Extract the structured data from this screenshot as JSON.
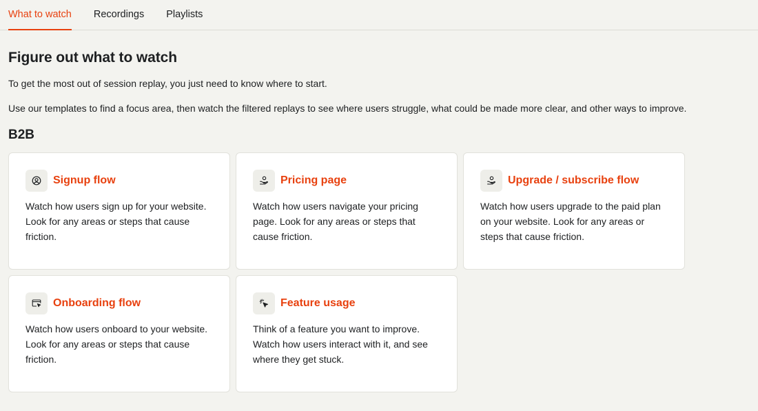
{
  "tabs": [
    {
      "label": "What to watch",
      "active": true
    },
    {
      "label": "Recordings",
      "active": false
    },
    {
      "label": "Playlists",
      "active": false
    }
  ],
  "main": {
    "title": "Figure out what to watch",
    "intro_1": "To get the most out of session replay, you just need to know where to start.",
    "intro_2": "Use our templates to find a focus area, then watch the filtered replays to see where users struggle, what could be made more clear, and other ways to improve.",
    "section_title": "B2B"
  },
  "cards": [
    {
      "icon": "user-circle-icon",
      "title": "Signup flow",
      "description": "Watch how users sign up for your website. Look for any areas or steps that cause friction."
    },
    {
      "icon": "hand-coin-icon",
      "title": "Pricing page",
      "description": "Watch how users navigate your pricing page. Look for any areas or steps that cause friction."
    },
    {
      "icon": "hand-coin-icon",
      "title": "Upgrade / subscribe flow",
      "description": "Watch how users upgrade to the paid plan on your website. Look for any areas or steps that cause friction."
    },
    {
      "icon": "browser-cursor-icon",
      "title": "Onboarding flow",
      "description": "Watch how users onboard to your website. Look for any areas or steps that cause friction."
    },
    {
      "icon": "cursor-click-icon",
      "title": "Feature usage",
      "description": "Think of a feature you want to improve. Watch how users interact with it, and see where they get stuck."
    }
  ],
  "colors": {
    "accent": "#e8410f",
    "background": "#f3f3ef",
    "card": "#ffffff"
  }
}
